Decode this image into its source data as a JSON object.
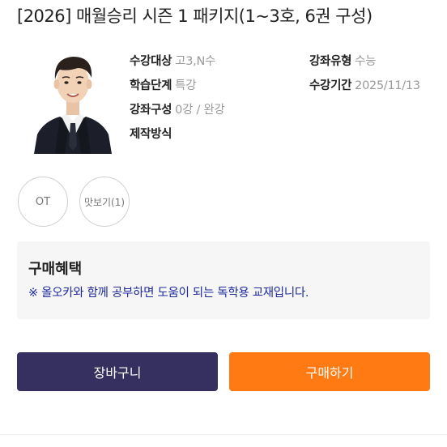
{
  "title": "[2026] 매월승리 시즌 1 패키지(1~3호, 6권 구성)",
  "info": {
    "course_target": {
      "key": "수강대상",
      "value": "고3,N수"
    },
    "course_type": {
      "key": "강좌유형",
      "value": "수능"
    },
    "study_level": {
      "key": "학습단계",
      "value": "특강"
    },
    "period": {
      "key": "수강기간",
      "value": "2025/11/13"
    },
    "composition": {
      "key": "강좌구성",
      "value": "0강 / 완강"
    },
    "production": {
      "key": "제작방식",
      "value": ""
    }
  },
  "preview": {
    "ot": "OT",
    "sample": "맛보기(1)"
  },
  "benefit": {
    "heading": "구매혜택",
    "description": "※ 올오카와 함께 공부하면 도움이 되는 독학용 교재입니다."
  },
  "actions": {
    "cart": "장바구니",
    "buy": "구매하기"
  },
  "colors": {
    "cart_button": "#35305f",
    "buy_button": "#ff7a12",
    "benefit_text": "#1f2a9c"
  }
}
